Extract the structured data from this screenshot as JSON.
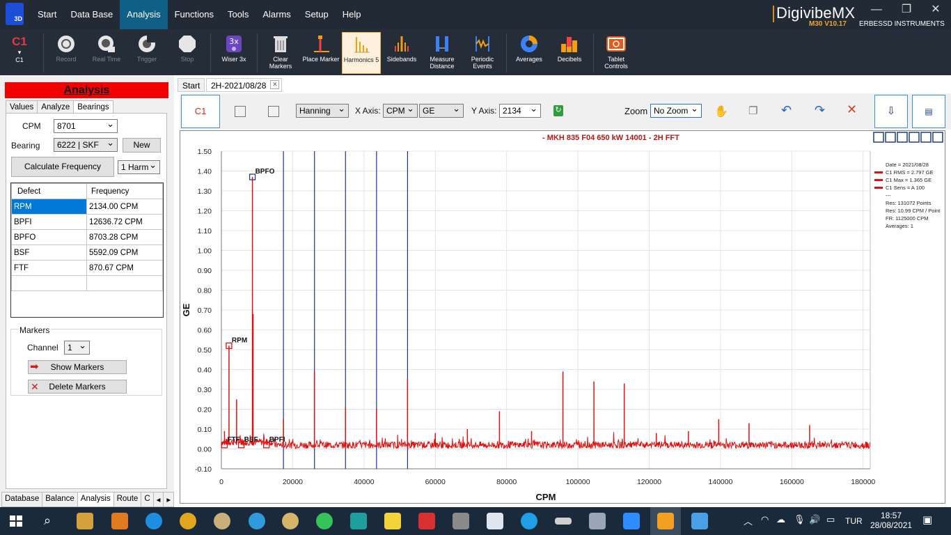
{
  "menu": {
    "items": [
      "Start",
      "Data Base",
      "Analysis",
      "Functions",
      "Tools",
      "Alarms",
      "Setup",
      "Help"
    ]
  },
  "brand": {
    "name": "DigivibeMX",
    "version": "M30 V10.17",
    "company": "ERBESSD INSTRUMENTS",
    "logo_sub": "3D"
  },
  "toolbar": {
    "channel": "C1",
    "channel_sub": "C1",
    "buttons": [
      "Record",
      "Real Time",
      "Trigger",
      "Stop",
      "Wiser 3x",
      "Clear Markers",
      "Place Marker",
      "Harmonics 5",
      "Sidebands",
      "Measure Distance",
      "Periodic Events",
      "Averages",
      "Decibels",
      "Tablet Controls"
    ]
  },
  "left": {
    "title": "Analysis",
    "tabs": [
      "Values",
      "Analyze",
      "Bearings"
    ],
    "cpm_label": "CPM",
    "cpm_value": "8701",
    "bearing_label": "Bearing",
    "bearing_value": "6222 | SKF",
    "new_label": "New",
    "calc_label": "Calculate Frequency",
    "harm_value": "1 Harm",
    "table": {
      "headers": [
        "Defect",
        "Frequency"
      ],
      "rows": [
        [
          "RPM",
          "2134.00 CPM"
        ],
        [
          "BPFI",
          "12636.72 CPM"
        ],
        [
          "BPFO",
          "8703.28 CPM"
        ],
        [
          "BSF",
          "5592.09 CPM"
        ],
        [
          "FTF",
          "870.67 CPM"
        ]
      ]
    },
    "markers_title": "Markers",
    "channel_label": "Channel",
    "channel_value": "1",
    "show_markers": "Show Markers",
    "delete_markers": "Delete Markers",
    "bottom_tabs": [
      "Database",
      "Balance",
      "Analysis",
      "Route",
      "C"
    ]
  },
  "main": {
    "doc_tabs": [
      "Start",
      "2H-2021/08/28"
    ],
    "controls": {
      "c1": "C1",
      "window": "Hanning",
      "xaxis_label": "X Axis:",
      "xaxis_value": "CPM",
      "unit_value": "GE",
      "yaxis_label": "Y Axis:",
      "yaxis_value": "2134",
      "zoom_label": "Zoom",
      "zoom_value": "No Zoom"
    }
  },
  "chart_data": {
    "type": "line",
    "title": "- MKH 835 F04 650 kW 14001 - 2H FFT",
    "xlabel": "CPM",
    "ylabel": "GE",
    "xlim": [
      0,
      182000
    ],
    "ylim": [
      -0.1,
      1.5
    ],
    "xticks": [
      0,
      20000,
      40000,
      60000,
      80000,
      100000,
      120000,
      140000,
      160000,
      180000
    ],
    "yticks": [
      "-0.10",
      "0.00",
      "0.10",
      "0.20",
      "0.30",
      "0.40",
      "0.50",
      "0.60",
      "0.70",
      "0.80",
      "0.90",
      "1.00",
      "1.10",
      "1.20",
      "1.30",
      "1.40",
      "1.50"
    ],
    "series_color": "#e01010",
    "peaks": [
      [
        870,
        0.09
      ],
      [
        2134,
        0.52
      ],
      [
        4268,
        0.25
      ],
      [
        5592,
        0.05
      ],
      [
        8703,
        1.37
      ],
      [
        8900,
        0.68
      ],
      [
        12636,
        0.05
      ],
      [
        17406,
        0.15
      ],
      [
        26109,
        0.39
      ],
      [
        34812,
        0.21
      ],
      [
        43515,
        0.2
      ],
      [
        52218,
        0.35
      ],
      [
        60000,
        0.08
      ],
      [
        69000,
        0.1
      ],
      [
        78000,
        0.19
      ],
      [
        87000,
        0.09
      ],
      [
        95800,
        0.39
      ],
      [
        104500,
        0.34
      ],
      [
        113000,
        0.33
      ],
      [
        122000,
        0.08
      ],
      [
        131000,
        0.09
      ],
      [
        139500,
        0.15
      ],
      [
        148000,
        0.13
      ],
      [
        165000,
        0.12
      ]
    ],
    "harmonic_lines": [
      17406,
      26109,
      34812,
      43515,
      52218
    ],
    "markers": [
      {
        "label": "BPFO",
        "x": 8703,
        "y": 1.37
      },
      {
        "label": "RPM",
        "x": 2134,
        "y": 0.52
      },
      {
        "label": "FTF",
        "x": 870,
        "y": 0.02
      },
      {
        "label": "BSF",
        "x": 5592,
        "y": 0.02
      },
      {
        "label": "BPFI",
        "x": 12636,
        "y": 0.02
      }
    ],
    "legend": {
      "date": "Date = 2021/08/28",
      "entries": [
        "C1 RMS = 2.797 GE",
        "C1 Max = 1.365 GE",
        "C1 Sens = A 100"
      ],
      "info": [
        "---",
        "Res: 131072 Points",
        "Res: 10.99 CPM / Point",
        "FR: 1125000 CPM",
        "Averages: 1"
      ]
    }
  },
  "taskbar": {
    "lang": "TUR",
    "time": "18:57",
    "date": "28/08/2021"
  }
}
